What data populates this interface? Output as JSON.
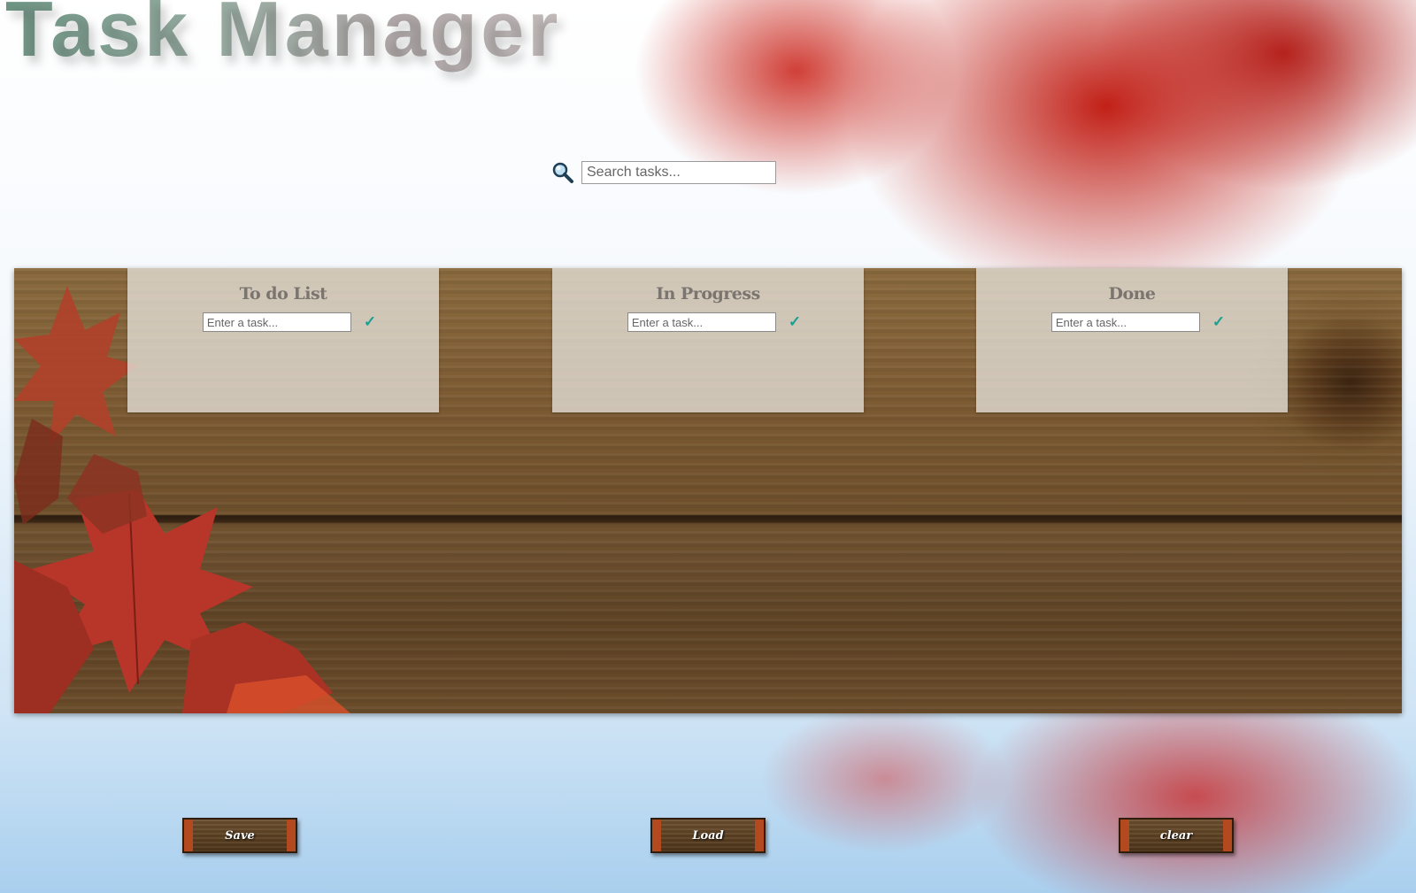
{
  "header": {
    "title": "Task Manager"
  },
  "search": {
    "placeholder": "Search tasks...",
    "icon": "magnifier-icon"
  },
  "columns": [
    {
      "title": "To do List",
      "input_placeholder": "Enter a task...",
      "confirm_symbol": "✓"
    },
    {
      "title": "In Progress",
      "input_placeholder": "Enter a task...",
      "confirm_symbol": "✓"
    },
    {
      "title": "Done",
      "input_placeholder": "Enter a task...",
      "confirm_symbol": "✓"
    }
  ],
  "actions": {
    "save_label": "Save",
    "load_label": "Load",
    "clear_label": "clear"
  },
  "colors": {
    "accent_check": "#1ba08f",
    "title_text": "#8aa89a",
    "column_title": "#7b7570"
  }
}
